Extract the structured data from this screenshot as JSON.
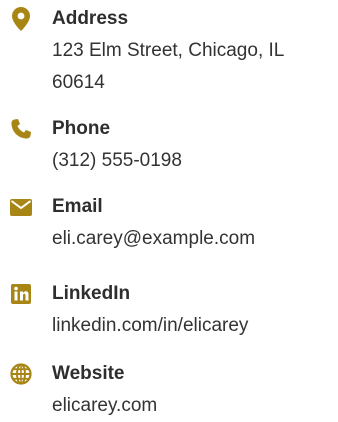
{
  "colors": {
    "accent": "#a88616",
    "text": "#333333"
  },
  "contacts": [
    {
      "icon": "map-marker-icon",
      "label": "Address",
      "value": "123 Elm Street, Chicago, IL 60614"
    },
    {
      "icon": "phone-icon",
      "label": "Phone",
      "value": "(312) 555-0198"
    },
    {
      "icon": "envelope-icon",
      "label": "Email",
      "value": "eli.carey@example.com"
    },
    {
      "icon": "linkedin-icon",
      "label": "LinkedIn",
      "value": "linkedin.com/in/elicarey"
    },
    {
      "icon": "globe-icon",
      "label": "Website",
      "value": "elicarey.com"
    }
  ]
}
